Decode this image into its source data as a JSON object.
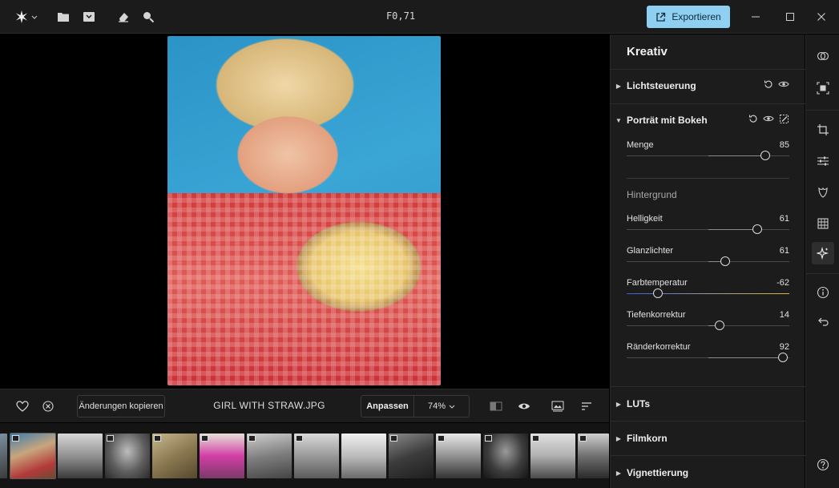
{
  "titlebar": {
    "title": "F0,71",
    "export_label": "Exportieren",
    "icons": [
      "app-logo-icon",
      "folder-icon",
      "import-icon",
      "eraser-icon",
      "search-icon"
    ],
    "window_controls": [
      "minimize-icon",
      "maximize-icon",
      "close-icon"
    ]
  },
  "canvas": {
    "image_description": "GIRL WITH STRAW.JPG"
  },
  "bottombar": {
    "copy_label": "Änderungen kopieren",
    "filename": "GIRL WITH STRAW.JPG",
    "fit_label": "Anpassen",
    "zoom_value": "74%"
  },
  "panel": {
    "title": "Kreativ",
    "sections": {
      "lichtsteuerung": "Lichtsteuerung",
      "portrait": "Porträt mit Bokeh",
      "hintergrund": "Hintergrund",
      "luts": "LUTs",
      "filmkorn": "Filmkorn",
      "vignettierung": "Vignettierung"
    },
    "sliders": [
      {
        "label": "Menge",
        "value": "85",
        "level": 0.85
      },
      {
        "label": "Helligkeit",
        "value": "61",
        "level": 0.805
      },
      {
        "label": "Glanzlichter",
        "value": "61",
        "level": 0.605
      },
      {
        "label": "Farbtemperatur",
        "value": "-62",
        "level": 0.19
      },
      {
        "label": "Tiefenkorrektur",
        "value": "14",
        "level": 0.57
      },
      {
        "label": "Ränderkorrektur",
        "value": "92",
        "level": 0.96
      }
    ]
  },
  "colors": {
    "accent": "#8fd0f2",
    "panel_bg": "#1c1c1c",
    "bar_bg": "#1b1b1b"
  },
  "filmstrip": {
    "thumbs": 13
  }
}
